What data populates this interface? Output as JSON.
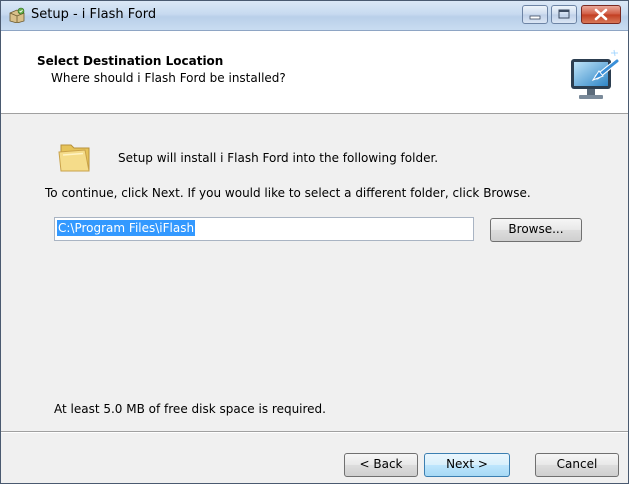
{
  "window": {
    "title": "Setup - i Flash Ford",
    "icons": {
      "app": "setup-box-icon",
      "minimize": "minimize-icon",
      "maximize": "maximize-icon",
      "close": "close-icon"
    }
  },
  "header": {
    "title": "Select Destination Location",
    "subtitle": "Where should i Flash Ford be installed?",
    "art_icon": "installer-computer-icon"
  },
  "body": {
    "folder_icon": "folder-icon",
    "intro": "Setup will install i Flash Ford into the following folder.",
    "instruction": "To continue, click Next. If you would like to select a different folder, click Browse.",
    "path_value": "C:\\Program Files\\iFlash",
    "browse_label": "Browse...",
    "space_note": "At least 5.0 MB of free disk space is required."
  },
  "footer": {
    "back_label": "< Back",
    "next_label": "Next >",
    "cancel_label": "Cancel"
  },
  "colors": {
    "selection": "#3399ff",
    "titlebar": "#c7daf0",
    "close_button": "#c23d21",
    "dialog_bg": "#f0f0f0"
  }
}
